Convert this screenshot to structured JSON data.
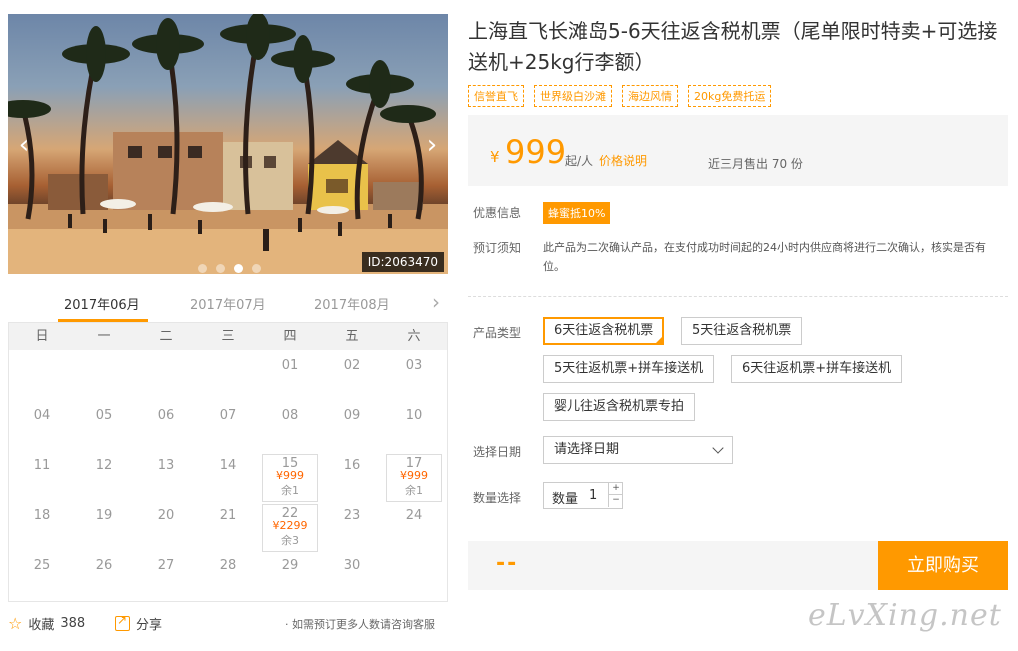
{
  "gallery": {
    "photo_id": "ID:2063470",
    "prev_icon": "‹",
    "next_icon": "›",
    "slide_count": 4,
    "active_slide": 3
  },
  "calendar": {
    "months": [
      "2017年06月",
      "2017年07月",
      "2017年08月"
    ],
    "active_month": 0,
    "next_icon": "›",
    "weekdays": [
      "日",
      "一",
      "二",
      "三",
      "四",
      "五",
      "六"
    ],
    "leading_blanks": 4,
    "days": [
      {
        "d": "01"
      },
      {
        "d": "02"
      },
      {
        "d": "03"
      },
      {
        "d": "04"
      },
      {
        "d": "05"
      },
      {
        "d": "06"
      },
      {
        "d": "07"
      },
      {
        "d": "08"
      },
      {
        "d": "09"
      },
      {
        "d": "10"
      },
      {
        "d": "11"
      },
      {
        "d": "12"
      },
      {
        "d": "13"
      },
      {
        "d": "14"
      },
      {
        "d": "15",
        "price": "¥999",
        "remain": "余1"
      },
      {
        "d": "16"
      },
      {
        "d": "17",
        "price": "¥999",
        "remain": "余1"
      },
      {
        "d": "18"
      },
      {
        "d": "19"
      },
      {
        "d": "20"
      },
      {
        "d": "21"
      },
      {
        "d": "22",
        "price": "¥2299",
        "remain": "余3"
      },
      {
        "d": "23"
      },
      {
        "d": "24"
      },
      {
        "d": "25"
      },
      {
        "d": "26"
      },
      {
        "d": "27"
      },
      {
        "d": "28"
      },
      {
        "d": "29"
      },
      {
        "d": "30"
      }
    ]
  },
  "footer": {
    "favorite_icon": "☆",
    "favorite_label": "收藏",
    "favorite_count": "388",
    "share_label": "分享",
    "consult_text": "· 如需预订更多人数请咨询客服"
  },
  "product": {
    "title": "上海直飞长滩岛5-6天往返含税机票（尾单限时特卖+可选接送机+25kg行李额）",
    "tags": [
      "信誉直飞",
      "世界级白沙滩",
      "海边风情",
      "20kg免费托运"
    ],
    "price": {
      "currency": "¥",
      "amount": "999",
      "unit": "起/人",
      "note": "价格说明",
      "sold": "近三月售出 70 份"
    },
    "promo_label": "优惠信息",
    "promo_badge": "蜂蜜抵10%",
    "notice_label": "预订须知",
    "notice_text": "此产品为二次确认产品，在支付成功时间起的24小时内供应商将进行二次确认，核实是否有位。",
    "type_label": "产品类型",
    "types": [
      "6天往返含税机票",
      "5天往返含税机票",
      "5天往返机票+拼车接送机",
      "6天往返机票+拼车接送机",
      "婴儿往返含税机票专拍"
    ],
    "selected_type": 0,
    "date_label": "选择日期",
    "date_placeholder": "请选择日期",
    "qty_label_left": "数量选择",
    "qty_label": "数量",
    "qty_value": "1",
    "qty_up": "+",
    "qty_down": "−",
    "total": "--",
    "buy_label": "立即购买"
  },
  "watermark": "eLvXing.net",
  "colors": {
    "accent": "#ff9900",
    "price": "#ff9900",
    "bar": "#f5f5f5"
  }
}
